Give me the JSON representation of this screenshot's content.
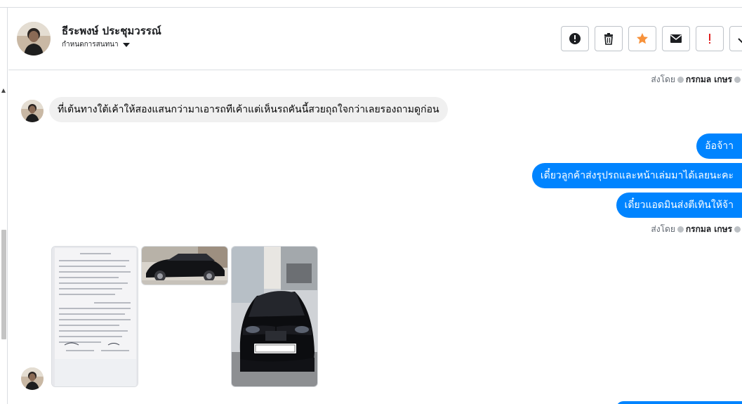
{
  "conversation": {
    "contact_name": "ธีระพงษ์ ประชุมวรรณ์",
    "label_dropdown": "กำหนดการสนทนา"
  },
  "toolbar": {
    "buttons": [
      {
        "name": "mark-spam-button",
        "icon": "exclamation-circle-icon"
      },
      {
        "name": "delete-button",
        "icon": "trash-icon"
      },
      {
        "name": "star-button",
        "icon": "star-icon",
        "color": "#f7923b"
      },
      {
        "name": "mark-unread-button",
        "icon": "envelope-icon"
      },
      {
        "name": "follow-up-button",
        "icon": "exclamation-icon",
        "color": "#e02020"
      },
      {
        "name": "done-button",
        "icon": "check-icon"
      }
    ]
  },
  "sent_by": {
    "prefix": "ส่งโดย",
    "agent": "กรกมล เกษร"
  },
  "messages": {
    "incoming_1": "ที่เต้นทางใต้เค้าให้สองแสนกว่ามาเอารถทีเค้าแต่เห็นรถคันนี้สวยถุถใจกว่าเลยรองถามดูก่อน",
    "outgoing_1": "อ้อจ้าา",
    "outgoing_2": "เดี๋ยวลูกค้าส่งรุปรถและหน้าเล่มมาได้เลยนะคะ",
    "outgoing_3": "เดี๋ยวแอดมินส่งตีเทินให้จ้า"
  },
  "colors": {
    "outgoing_bubble": "#0084ff",
    "incoming_bubble": "#f0f0f0"
  }
}
